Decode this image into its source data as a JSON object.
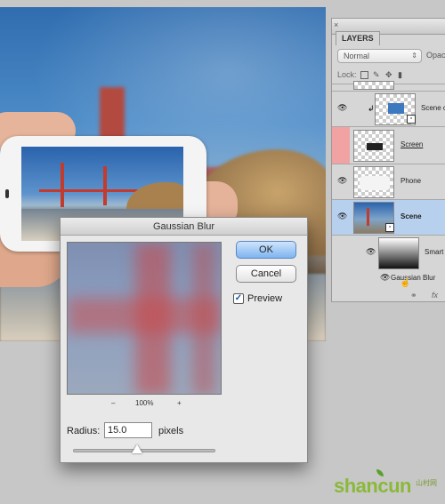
{
  "layers_panel": {
    "tab_label": "LAYERS",
    "blend_mode": "Normal",
    "opacity_label": "Opaci",
    "lock_label": "Lock:",
    "layers": [
      {
        "name": "Scene c",
        "style": "normal"
      },
      {
        "name": "Screen",
        "style": "underline"
      },
      {
        "name": "Phone",
        "style": "normal"
      },
      {
        "name": "Scene",
        "style": "bold",
        "selected": true
      },
      {
        "name": "Smart",
        "style": "normal"
      },
      {
        "name": "Gaussian Blur",
        "style": "normal"
      }
    ],
    "bottom_icon_fx": "fx",
    "colors": {
      "selected_row": "#b7d0ee",
      "hidden_layer_eye": "#f1a3a3"
    }
  },
  "dialog": {
    "title": "Gaussian Blur",
    "ok_label": "OK",
    "cancel_label": "Cancel",
    "preview_label": "Preview",
    "preview_checked": true,
    "zoom_minus": "–",
    "zoom_level": "100%",
    "zoom_plus": "+",
    "radius_label": "Radius:",
    "radius_value": "15.0",
    "radius_unit": "pixels",
    "radius_slider_level": 0.45
  },
  "watermark": {
    "text_part1": "shan",
    "text_part2": "cun",
    "sub_text": "山村网"
  }
}
